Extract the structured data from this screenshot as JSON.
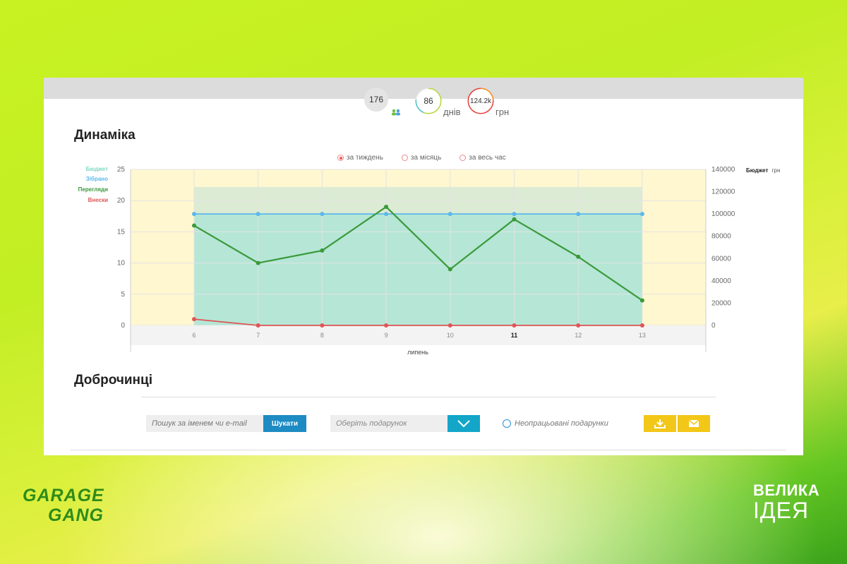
{
  "stats": {
    "supporters": "176",
    "days": "86",
    "days_label": "днів",
    "money": "124.2k",
    "money_label": "грн"
  },
  "dynamics": {
    "title": "Динаміка",
    "period_options": [
      "за тиждень",
      "за місяць",
      "за весь час"
    ],
    "selected_period": "за тиждень"
  },
  "chart_data": {
    "type": "line",
    "x": [
      "6",
      "7",
      "8",
      "9",
      "10",
      "11",
      "12",
      "13"
    ],
    "xlabel": "липень",
    "y_left_ticks": [
      "0",
      "5",
      "10",
      "15",
      "20",
      "25"
    ],
    "y_right_ticks": [
      "0",
      "20000",
      "40000",
      "60000",
      "80000",
      "100000",
      "120000",
      "140000"
    ],
    "ylim_left": [
      0,
      25
    ],
    "ylim_right": [
      0,
      140000
    ],
    "right_axis_label": "Бюджет",
    "right_axis_unit": "грн",
    "legend": [
      {
        "name": "Бюджет",
        "color": "#7fd6c4"
      },
      {
        "name": "Зібрано",
        "color": "#5bb8ec"
      },
      {
        "name": "Перегляди",
        "color": "#3a9a3a"
      },
      {
        "name": "Внески",
        "color": "#e05555"
      }
    ],
    "series": [
      {
        "name": "Бюджет",
        "axis": "right",
        "values": [
          124200,
          124200,
          124200,
          124200,
          124200,
          124200,
          124200,
          124200
        ]
      },
      {
        "name": "Зібрано",
        "axis": "right",
        "values": [
          100000,
          100000,
          100000,
          100000,
          100000,
          100000,
          100000,
          100000
        ]
      },
      {
        "name": "Перегляди",
        "axis": "left",
        "values": [
          16,
          10,
          12,
          19,
          9,
          17,
          11,
          4
        ]
      },
      {
        "name": "Внески",
        "axis": "left",
        "values": [
          1,
          0,
          0,
          0,
          0,
          0,
          0,
          0
        ]
      }
    ]
  },
  "donors": {
    "title": "Доброчинці",
    "search_placeholder": "Пошук за іменем чи e-mail",
    "search_button": "Шукати",
    "gift_select": "Оберіть подарунок",
    "unprocessed_label": "Неопрацьовані подарунки"
  },
  "brands": {
    "left_line1": "GARAGE",
    "left_line2": "GANG",
    "right_line1": "ВЕЛИКА",
    "right_line2": "ІДЕЯ"
  }
}
